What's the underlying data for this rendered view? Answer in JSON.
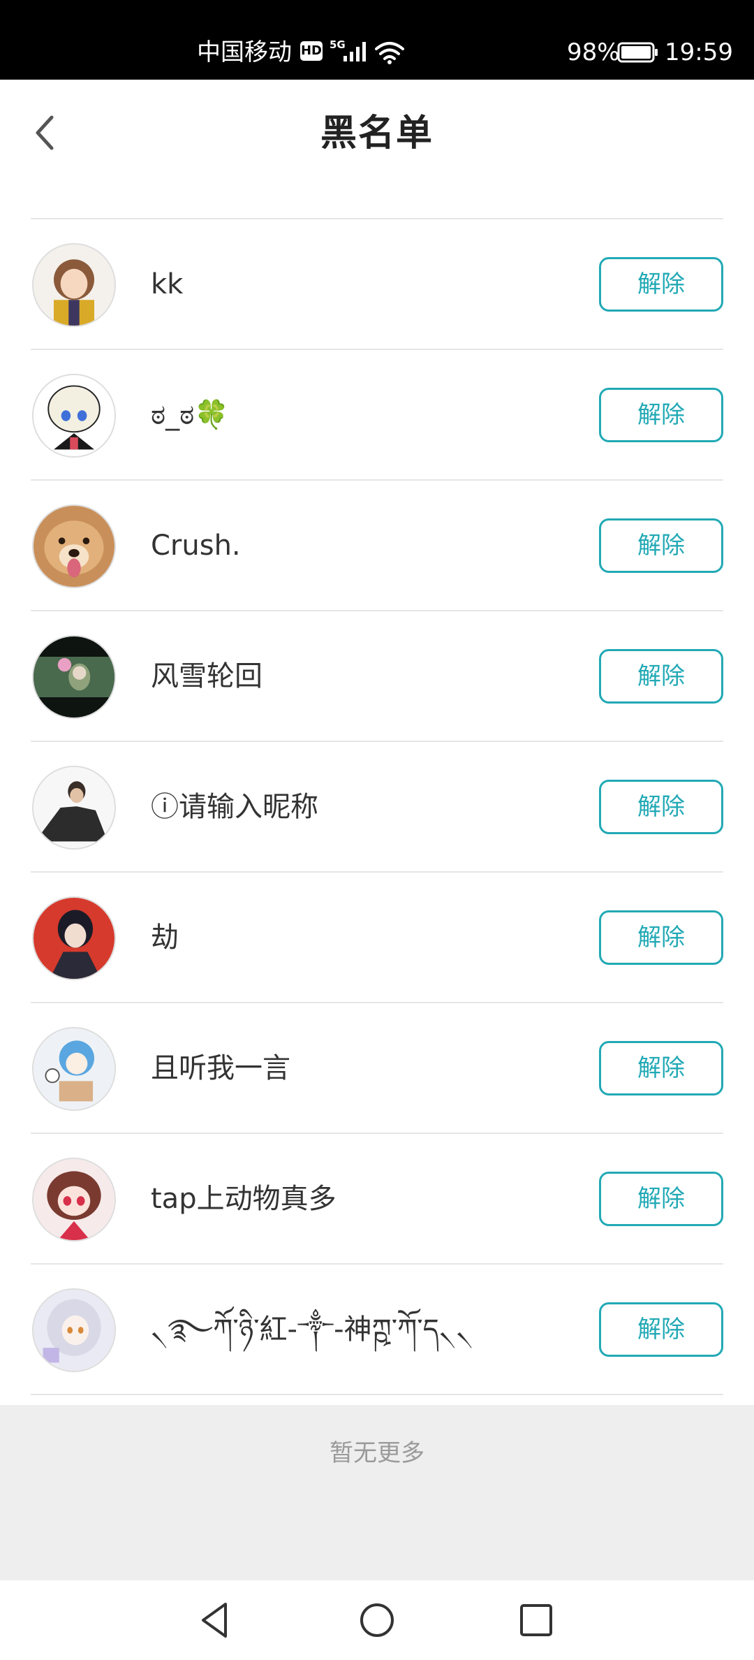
{
  "status_bar": {
    "carrier": "中国移动",
    "hd_badge": "HD",
    "network_type": "5G",
    "battery_percent": "98%",
    "time": "19:59",
    "signal_icon": "signal-bars-icon",
    "wifi_icon": "wifi-icon",
    "battery_icon": "battery-icon"
  },
  "header": {
    "title": "黑名单",
    "back_icon": "chevron-left-icon"
  },
  "blacklist": {
    "remove_label": "解除",
    "accent_color": "#22a9b5",
    "items": [
      {
        "nickname": "kk",
        "avatar": "avatar-anime-girl-brown-hair"
      },
      {
        "nickname": "ಠ_ಠ🍀",
        "avatar": "avatar-chibi-white-hair"
      },
      {
        "nickname": "Crush.",
        "avatar": "avatar-shiba-dog"
      },
      {
        "nickname": "风雪轮回",
        "avatar": "avatar-dark-scene-girl"
      },
      {
        "nickname": "ⓘ请输入昵称",
        "avatar": "avatar-man-sketch"
      },
      {
        "nickname": "劫",
        "avatar": "avatar-red-background-boy"
      },
      {
        "nickname": "且听我一言",
        "avatar": "avatar-blue-hair-chibi"
      },
      {
        "nickname": "tap上动物真多",
        "avatar": "avatar-pink-chibi"
      },
      {
        "nickname": "৲࿐ཀོ་ཉི་紅-༒-神ཀྵ་ཀོ་ད৲৲",
        "avatar": "avatar-silver-hair-girl"
      }
    ]
  },
  "footer": {
    "no_more_text": "暂无更多"
  },
  "nav_bar": {
    "back_icon": "triangle-back-icon",
    "home_icon": "circle-home-icon",
    "recent_icon": "square-recent-icon"
  }
}
